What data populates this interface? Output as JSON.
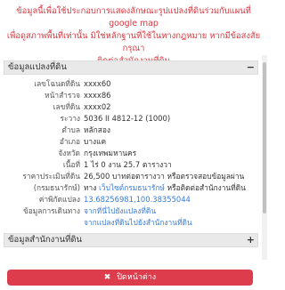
{
  "notice": {
    "line1": "ข้อมูลนี้เพื่อใช้ประกอบการแสดงลักษณะรูปแปลงที่ดินร่วมกับแผนที่ google map",
    "line2": "เพื่อดูสภาพพื้นที่เท่านั้น มิใช่หลักฐานที่ใช้ในทางกฎหมาย หากมีข้อสงสัย กรุณา",
    "line3": "ติดต่อสำนักงานที่ดิน"
  },
  "land_section": {
    "title": "ข้อมูลแปลงที่ดิน",
    "toggle": "−",
    "rows": [
      {
        "label": "เลขโฉนดที่ดิน",
        "value": "xxxx60"
      },
      {
        "label": "หน้าสำรวจ",
        "value": "xxxx86"
      },
      {
        "label": "เลขที่ดิน",
        "value": "xxxx02"
      },
      {
        "label": "ระวาง",
        "value": "5036 II 4812-12 (1000)"
      },
      {
        "label": "ตำบล",
        "value": "หลักสอง"
      },
      {
        "label": "อำเภอ",
        "value": "บางแค"
      },
      {
        "label": "จังหวัด",
        "value": "กรุงเทพมหานคร"
      },
      {
        "label": "เนื้อที่",
        "value": "1 ไร่ 0 งาน 25.7 ตารางวา"
      }
    ],
    "price_label1": "ราคาประเมินที่ดิน",
    "price_label2": "(กรมธนารักษ์)",
    "price_line1": "26,500 บาทต่อตารางวา หรือตรวจสอบข้อมูลผ่าน",
    "price_prefix": "ทาง",
    "price_link": "เว็บไซต์กรมธนารักษ์",
    "price_suffix": "หรือติดต่อสำนักงานที่ดิน",
    "coord_label": "ค่าพิกัดแปลง",
    "coord_value": "13.68256981,100.38355044",
    "travel_label": "ข้อมูลการเดินทาง",
    "travel_link1": "จากที่นี่ไปยังแปลงที่ดิน",
    "travel_link2": "จากแปลงที่ดินไปยังสำนักงานที่ดิน"
  },
  "office_section": {
    "title": "ข้อมูลสำนักงานที่ดิน",
    "toggle": "+"
  },
  "close_button": {
    "icon": "✖",
    "label": "ปิดหน้าต่าง"
  },
  "colors": {
    "notice": "#d9363e",
    "link": "#3a7bd5",
    "close_button": "#dc3c4b"
  }
}
